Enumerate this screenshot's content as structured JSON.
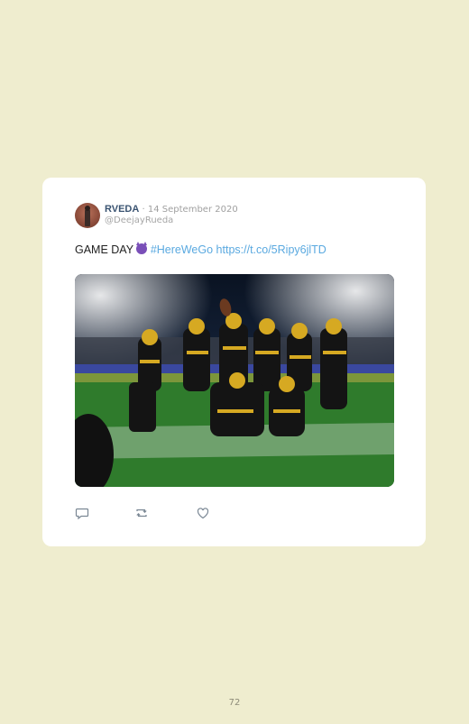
{
  "tweet": {
    "name": "RVEDA",
    "date": "14 September 2020",
    "separator": "·",
    "handle": "@DeejayRueda",
    "text_prefix": "GAME DAY",
    "emoji_icon": "smiling-devil-emoji",
    "hashtag": "#HereWeGo",
    "url": "https://t.co/5Ripy6jlTD"
  },
  "actions": {
    "reply_icon": "reply-icon",
    "retweet_icon": "retweet-icon",
    "like_icon": "heart-icon"
  },
  "page_number": "72",
  "colors": {
    "background": "#efedcf",
    "card": "#ffffff",
    "link": "#5aa9e0",
    "name": "#3b5472"
  }
}
